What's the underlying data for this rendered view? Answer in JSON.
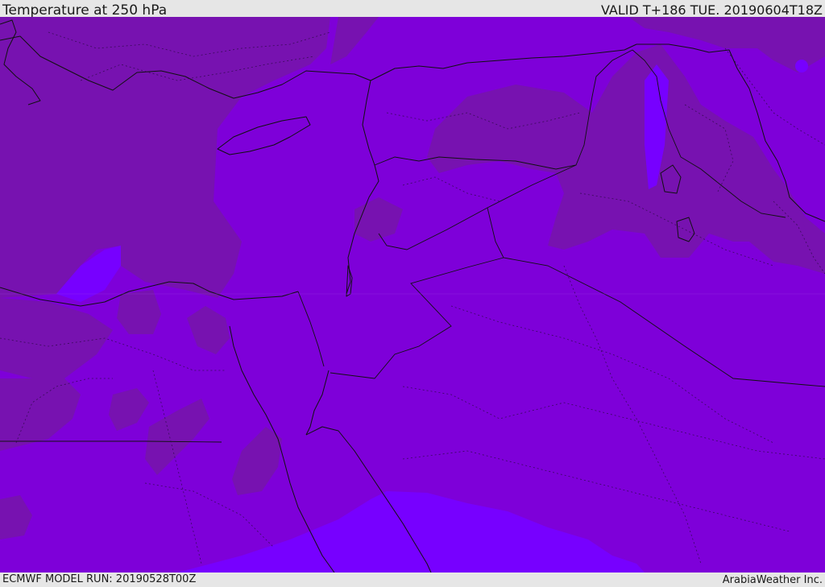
{
  "header": {
    "title": "Temperature at 250 hPa",
    "valid_time": "VALID T+186 TUE. 20190604T18Z"
  },
  "footer": {
    "model_run": "ECMWF MODEL RUN: 20190528T00Z",
    "credit": "ArabiaWeather Inc."
  },
  "map": {
    "field": "temperature",
    "level": "250 hPa",
    "colors": {
      "base": "#7e00d9",
      "warmer": "#7712b0",
      "colder": "#7700ff",
      "coast_lines": "#111111"
    }
  }
}
